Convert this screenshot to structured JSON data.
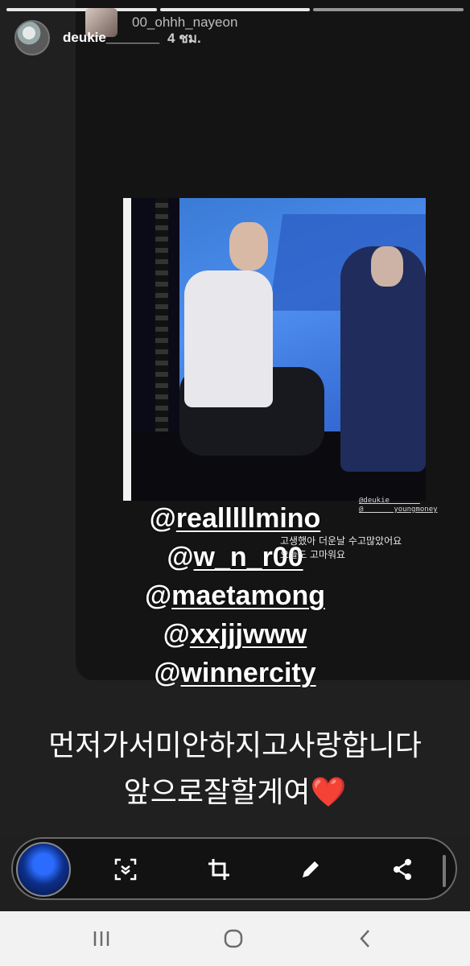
{
  "story": {
    "username": "deukie_______",
    "progress_segments": 3,
    "progress_done": 2
  },
  "inner_post": {
    "username": "00_ohhh_nayeon",
    "time": "4 ชม."
  },
  "photo_tags": [
    "@deukie_______",
    "@_______youngmoney"
  ],
  "photo_caption": [
    "고생했아 더운날 수고많았어요",
    "오늘도 고마워요"
  ],
  "mentions": [
    "@realllllmino",
    "@w_n_r00",
    "@maetamong",
    "@xxjjjwww",
    "@winnercity"
  ],
  "message": {
    "line1": "먼저가서미안하지고사랑합니다",
    "line2": "앞으로잘할게여",
    "heart": "❤️"
  },
  "toolbar": {
    "icons": [
      "smart-select-icon",
      "crop-icon",
      "draw-icon",
      "share-icon"
    ]
  },
  "navbar": {
    "recents": "|||",
    "home": "◯",
    "back": "‹"
  }
}
